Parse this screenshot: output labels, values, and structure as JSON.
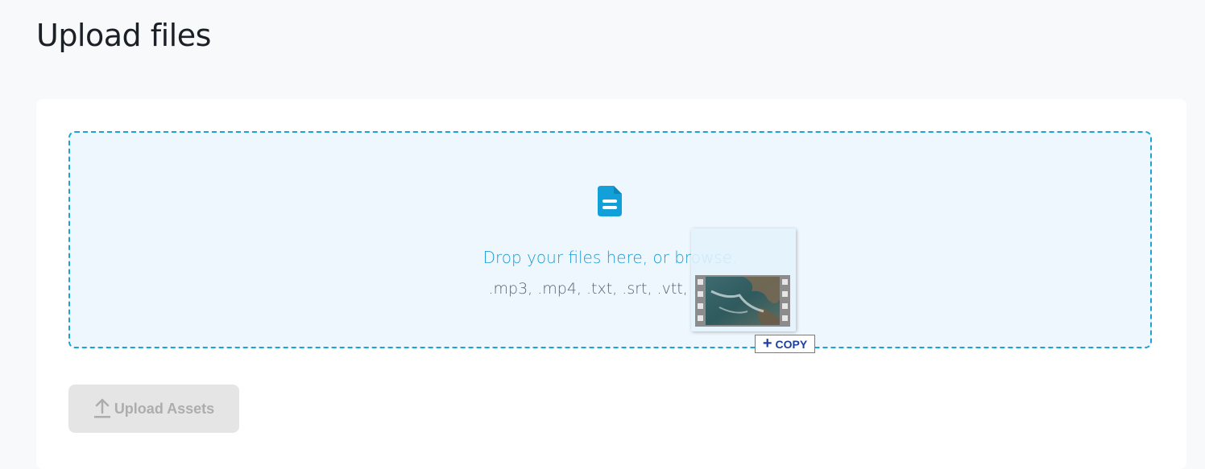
{
  "page": {
    "title": "Upload files"
  },
  "dropzone": {
    "prompt": "Drop your files here, or browse.",
    "accepted_types": ".mp3, .mp4, .txt, .srt, .vtt, .mp4",
    "icon": "file-icon",
    "accent_color": "#1aa3d4"
  },
  "drag_indicator": {
    "action_label": "COPY",
    "icon": "video-file-icon"
  },
  "actions": {
    "upload_label": "Upload Assets",
    "upload_icon": "upload-icon",
    "upload_disabled": true
  }
}
